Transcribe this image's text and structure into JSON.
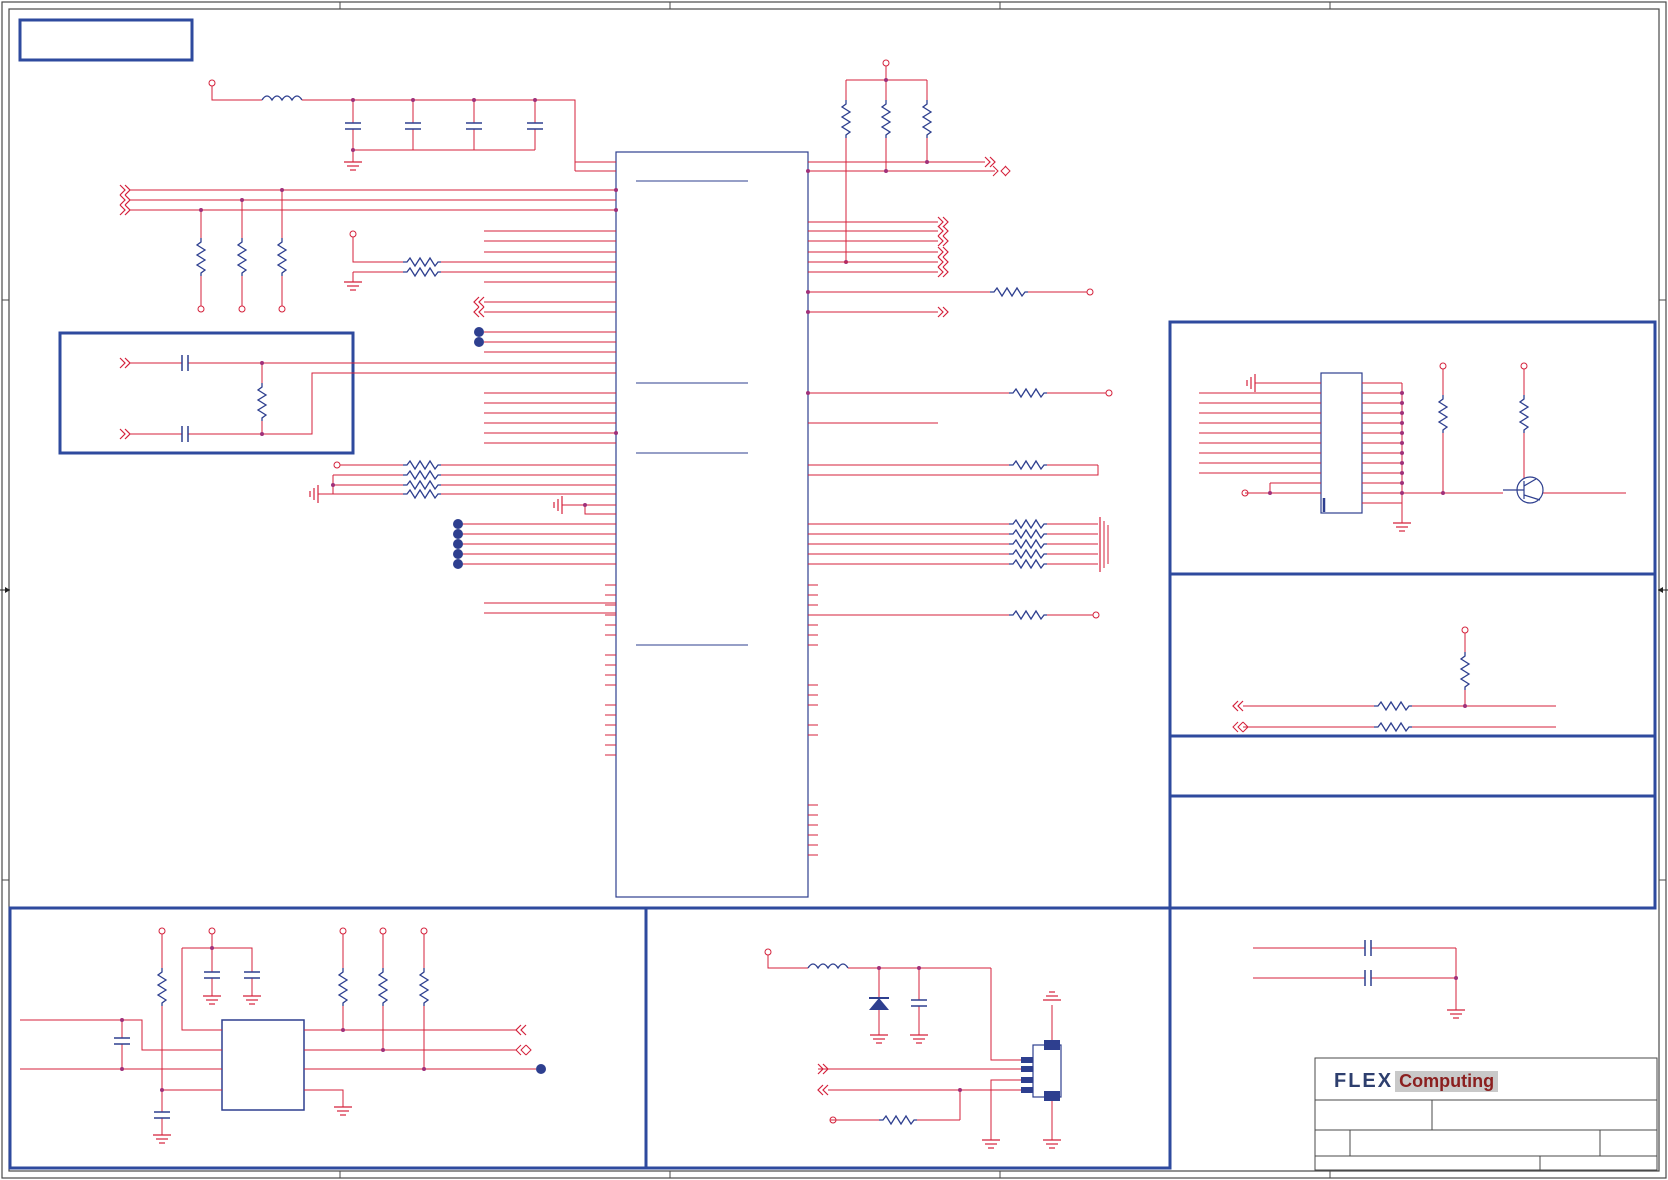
{
  "title_block": {
    "logo_brand": "FLEX",
    "logo_x": "X",
    "logo_product": "Computing"
  },
  "colors": {
    "wire": "#d4213b",
    "component": "#2e3f8f",
    "junction": "#a0307a",
    "frame": "#2e4a9e",
    "logo_dark": "#2e3f6e",
    "logo_accent": "#8b1f1f"
  }
}
